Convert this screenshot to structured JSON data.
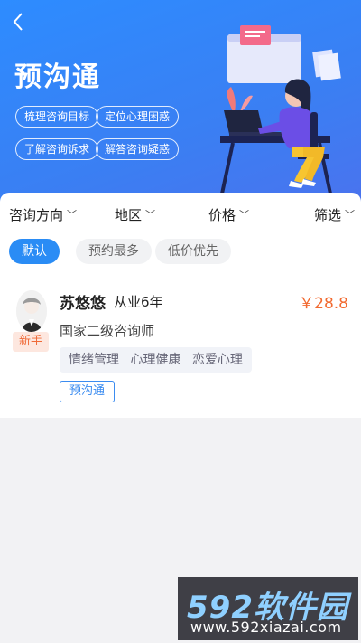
{
  "header": {
    "back_icon": "chevron-left-icon",
    "title": "预沟通",
    "chips": [
      "梳理咨询目标",
      "定位心理困惑",
      "了解咨询诉求",
      "解答咨询疑惑"
    ]
  },
  "filters": {
    "items": [
      "咨询方向",
      "地区",
      "价格",
      "筛选"
    ],
    "chevron_icon": "chevron-down-icon"
  },
  "sort": {
    "options": [
      "默认",
      "预约最多",
      "低价优先"
    ],
    "selected": "默认"
  },
  "counselor": {
    "name": "苏悠悠",
    "experience": "从业6年",
    "price": "￥28.8",
    "badge": "新手",
    "certificate": "国家二级咨询师",
    "tags": [
      "情绪管理",
      "心理健康",
      "恋爱心理"
    ],
    "action": "预沟通"
  },
  "watermark": {
    "logo": "592软件园",
    "url": "www.592xiazai.com"
  },
  "colors": {
    "primary": "#2a8cf5",
    "price": "#f26a30",
    "badge_bg": "#fde7df"
  }
}
